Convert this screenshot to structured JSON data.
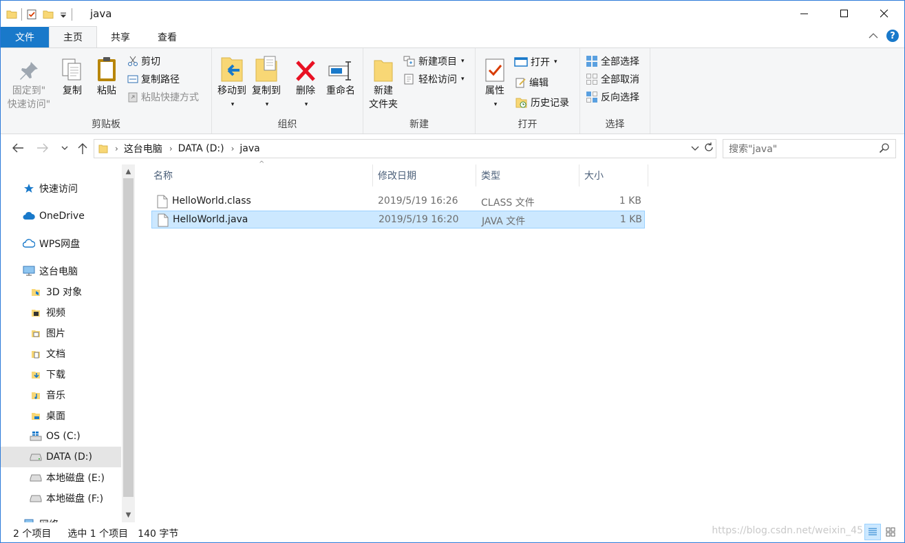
{
  "window": {
    "title": "java",
    "minimize": "─",
    "maximize": "☐",
    "close": "✕"
  },
  "tabs": {
    "file": "文件",
    "home": "主页",
    "share": "共享",
    "view": "查看",
    "collapse": "^",
    "help": "?"
  },
  "ribbon": {
    "clipboard": {
      "label": "剪贴板",
      "pin_line1": "固定到\"",
      "pin_line2": "快速访问\"",
      "copy": "复制",
      "paste": "粘贴",
      "cut": "剪切",
      "copy_path": "复制路径",
      "paste_shortcut": "粘贴快捷方式"
    },
    "organize": {
      "label": "组织",
      "move_to": "移动到",
      "copy_to": "复制到",
      "delete": "删除",
      "rename": "重命名"
    },
    "new": {
      "label": "新建",
      "new_folder_line1": "新建",
      "new_folder_line2": "文件夹",
      "new_item": "新建项目",
      "easy_access": "轻松访问"
    },
    "open": {
      "label": "打开",
      "properties": "属性",
      "open": "打开",
      "edit": "编辑",
      "history": "历史记录"
    },
    "select": {
      "label": "选择",
      "select_all": "全部选择",
      "select_none": "全部取消",
      "invert": "反向选择"
    }
  },
  "address": {
    "root": "这台电脑",
    "drive": "DATA (D:)",
    "folder": "java"
  },
  "search": {
    "placeholder": "搜索\"java\""
  },
  "nav": {
    "quick_access": "快速访问",
    "onedrive": "OneDrive",
    "wps": "WPS网盘",
    "this_pc": "这台电脑",
    "objects3d": "3D 对象",
    "videos": "视频",
    "pictures": "图片",
    "documents": "文档",
    "downloads": "下载",
    "music": "音乐",
    "desktop": "桌面",
    "c_drive": "OS (C:)",
    "d_drive": "DATA (D:)",
    "e_drive": "本地磁盘 (E:)",
    "f_drive": "本地磁盘 (F:)",
    "network": "网络"
  },
  "columns": {
    "name": "名称",
    "date": "修改日期",
    "type": "类型",
    "size": "大小"
  },
  "files": [
    {
      "name": "HelloWorld.class",
      "date": "2019/5/19 16:26",
      "type": "CLASS 文件",
      "size": "1 KB"
    },
    {
      "name": "HelloWorld.java",
      "date": "2019/5/19 16:20",
      "type": "JAVA 文件",
      "size": "1 KB"
    }
  ],
  "status": {
    "count": "2 个项目",
    "selected": "选中 1 个项目",
    "size": "140 字节",
    "watermark": "https://blog.csdn.net/weixin_45"
  },
  "colors": {
    "accent": "#1979ca",
    "selection": "#cce8ff",
    "folder": "#f8d775"
  }
}
